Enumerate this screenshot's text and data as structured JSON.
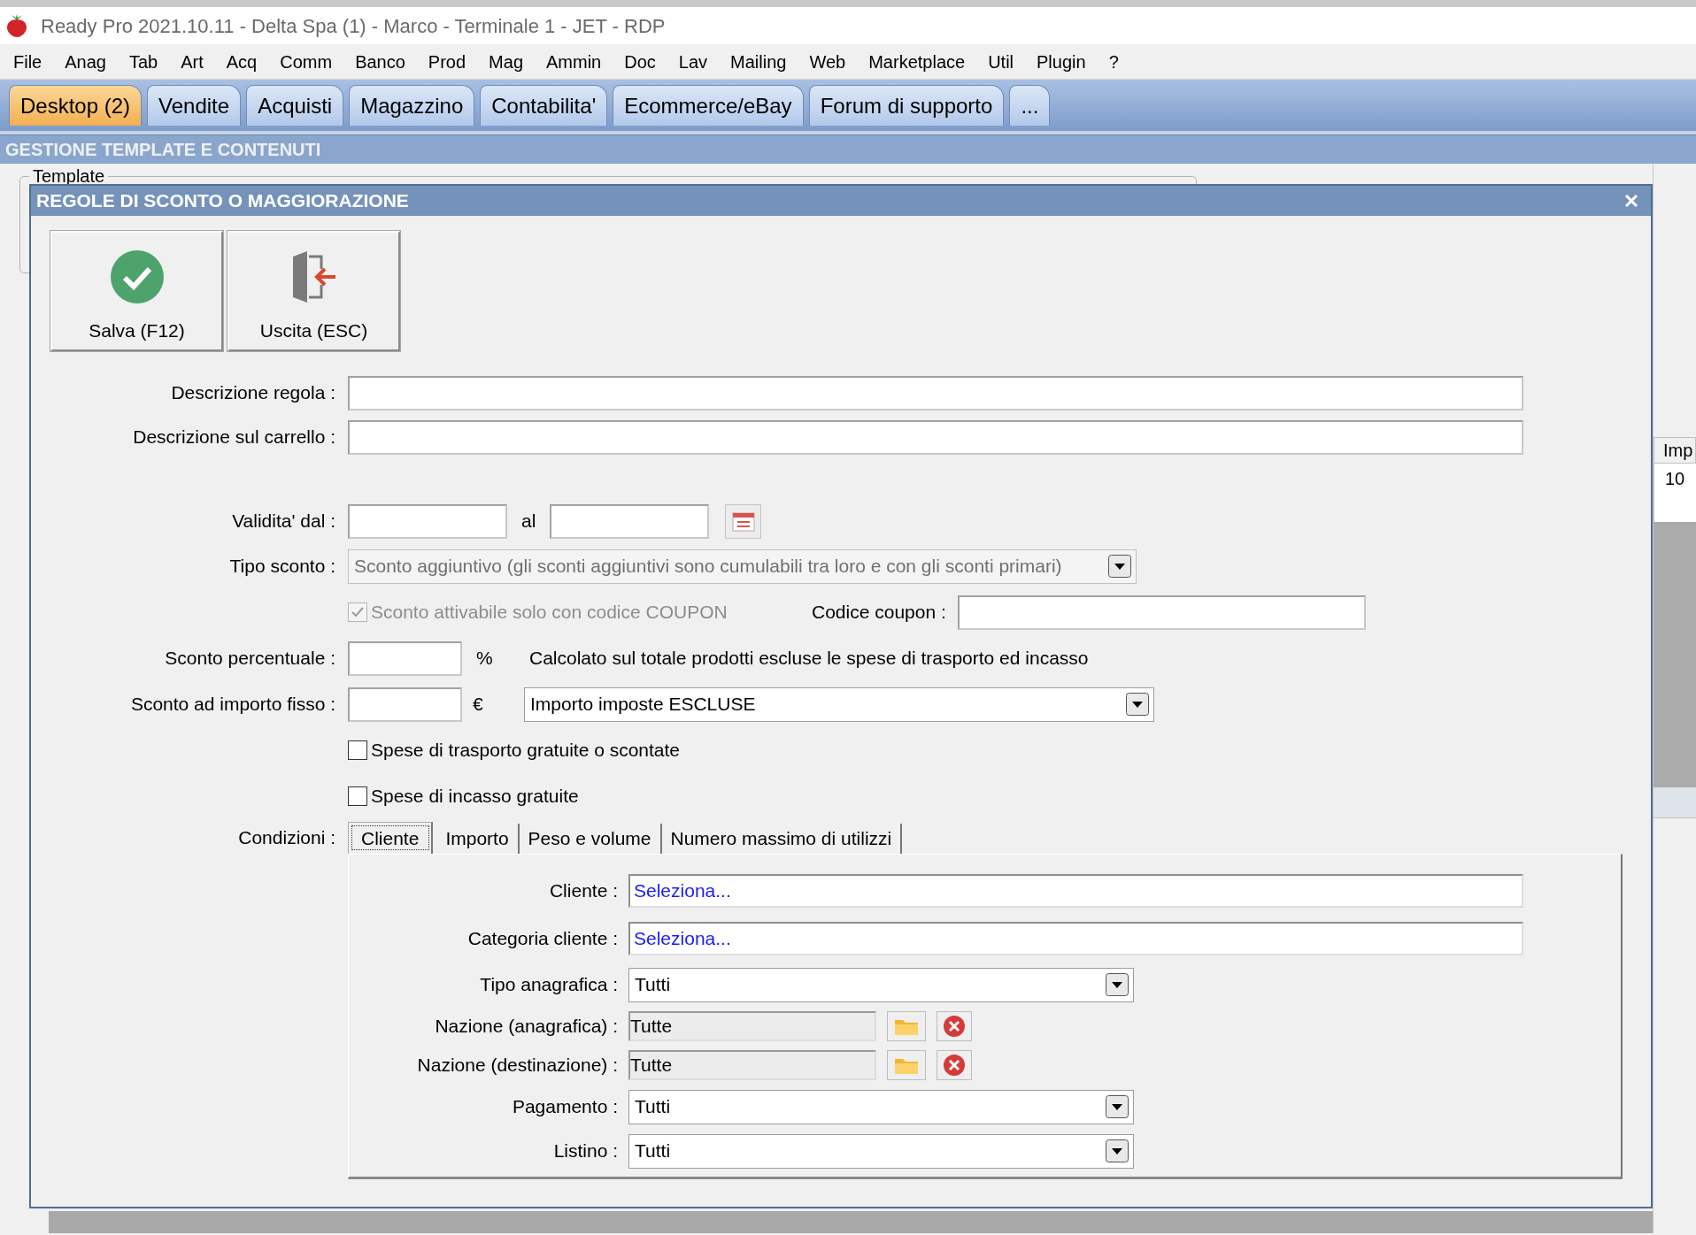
{
  "window": {
    "title": "Ready Pro 2021.10.11 - Delta Spa (1) - Marco - Terminale 1 - JET - RDP"
  },
  "menu": [
    "File",
    "Anag",
    "Tab",
    "Art",
    "Acq",
    "Comm",
    "Banco",
    "Prod",
    "Mag",
    "Ammin",
    "Doc",
    "Lav",
    "Mailing",
    "Web",
    "Marketplace",
    "Util",
    "Plugin",
    "?"
  ],
  "tabs": [
    {
      "label": "Desktop (2)",
      "selected": true
    },
    {
      "label": "Vendite",
      "selected": false
    },
    {
      "label": "Acquisti",
      "selected": false
    },
    {
      "label": "Magazzino",
      "selected": false
    },
    {
      "label": "Contabilita'",
      "selected": false
    },
    {
      "label": "Ecommerce/eBay",
      "selected": false
    },
    {
      "label": "Forum di supporto",
      "selected": false
    },
    {
      "label": "...",
      "selected": false
    }
  ],
  "section_header": "GESTIONE TEMPLATE E CONTENUTI",
  "background": {
    "group_label": "Template",
    "table": {
      "columns": [
        "Imp"
      ],
      "rows": [
        [
          "10"
        ]
      ]
    }
  },
  "dialog": {
    "title": "REGOLE DI SCONTO O MAGGIORAZIONE",
    "toolbar": [
      {
        "label": "Salva (F12)",
        "kind": "save"
      },
      {
        "label": "Uscita (ESC)",
        "kind": "exit"
      }
    ],
    "rows": [
      {
        "kind": "text",
        "label": "Descrizione regola :"
      },
      {
        "kind": "text",
        "label": "Descrizione sul carrello :"
      },
      {
        "kind": "date_range",
        "label": "Validita' dal :",
        "separator": "al"
      },
      {
        "kind": "select",
        "label": "Tipo sconto :",
        "value": "Sconto aggiuntivo (gli sconti aggiuntivi sono cumulabili tra loro e con gli sconti primari)",
        "disabled": true
      },
      {
        "kind": "coupon",
        "checkbox": {
          "label": "Sconto attivabile solo con codice COUPON",
          "checked": true,
          "disabled": true
        },
        "field_label": "Codice coupon :"
      },
      {
        "kind": "percent",
        "label": "Sconto percentuale :",
        "unit": "%",
        "note": "Calcolato sul totale prodotti escluse le spese di trasporto ed incasso"
      },
      {
        "kind": "fixed",
        "label": "Sconto ad importo fisso :",
        "unit": "€",
        "select": "Importo imposte ESCLUSE"
      },
      {
        "kind": "checkbox",
        "label": "Spese di trasporto gratuite o scontate",
        "checked": false,
        "disabled": false
      },
      {
        "kind": "checkbox",
        "label": "Spese di incasso gratuite",
        "checked": false,
        "disabled": false
      }
    ],
    "conditions": {
      "label": "Condizioni :",
      "tabs": [
        {
          "label": "Cliente",
          "selected": true
        },
        {
          "label": "Importo",
          "selected": false
        },
        {
          "label": "Peso e volume",
          "selected": false
        },
        {
          "label": "Numero massimo di utilizzi",
          "selected": false
        }
      ],
      "rows": [
        {
          "kind": "picker",
          "label": "Cliente :",
          "value": "Seleziona..."
        },
        {
          "kind": "picker",
          "label": "Categoria cliente :",
          "value": "Seleziona..."
        },
        {
          "kind": "select",
          "label": "Tipo anagrafica :",
          "value": "Tutti"
        },
        {
          "kind": "nation",
          "label": "Nazione (anagrafica) :",
          "value": "Tutte"
        },
        {
          "kind": "nation",
          "label": "Nazione (destinazione) :",
          "value": "Tutte"
        },
        {
          "kind": "select",
          "label": "Pagamento :",
          "value": "Tutti"
        },
        {
          "kind": "select",
          "label": "Listino :",
          "value": "Tutti"
        }
      ]
    }
  }
}
